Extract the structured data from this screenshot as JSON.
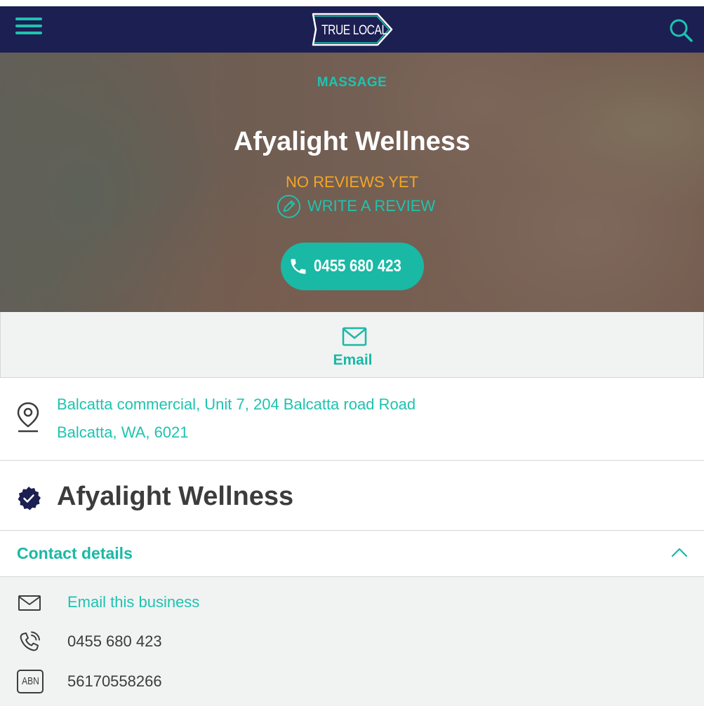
{
  "header": {
    "logo_text": "TRUE LOCAL",
    "menu_icon": "hamburger-menu-icon",
    "search_icon": "search-icon",
    "colors": {
      "navbar": "#1c1f52",
      "accent": "#1ec3b0"
    }
  },
  "hero": {
    "category": "MASSAGE",
    "title": "Afyalight Wellness",
    "reviews_status": "NO REVIEWS YET",
    "write_review_label": "WRITE A REVIEW",
    "write_review_icon": "pencil-icon",
    "call_button_label": "0455 680 423",
    "call_icon": "phone-icon",
    "colors": {
      "reviews": "#f5a623",
      "call_button": "#19b9a5"
    }
  },
  "actions": {
    "email_label": "Email",
    "email_icon": "envelope-icon"
  },
  "address": {
    "line1": "Balcatta commercial, Unit 7, 204 Balcatta road Road",
    "line2": "Balcatta, WA, 6021",
    "icon": "location-pin-icon"
  },
  "business": {
    "name": "Afyalight Wellness",
    "verified_icon": "verified-badge-icon"
  },
  "contact_details": {
    "title": "Contact details",
    "toggle_icon": "chevron-up-icon",
    "items": [
      {
        "icon": "envelope-icon",
        "text": "Email this business"
      },
      {
        "icon": "phone-ringing-icon",
        "text": "0455 680 423"
      },
      {
        "icon": "abn-icon",
        "badge": "ABN",
        "text": "56170558266"
      }
    ]
  }
}
